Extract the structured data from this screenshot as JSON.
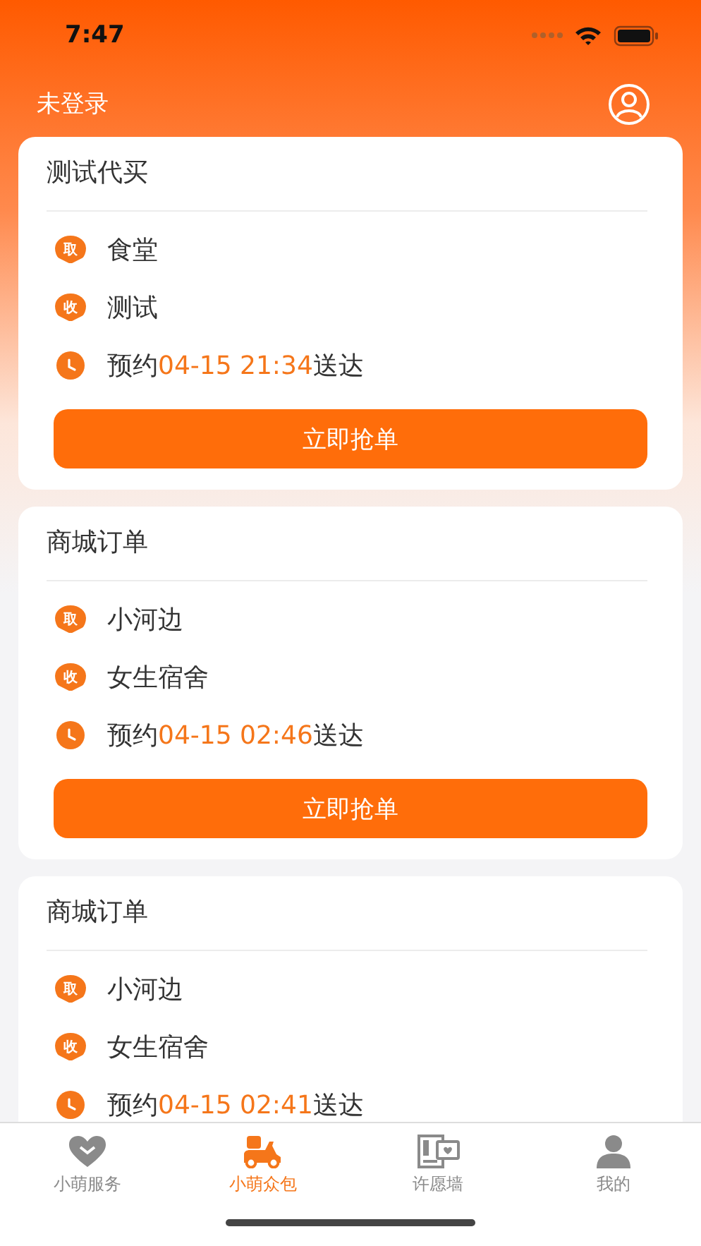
{
  "status_bar": {
    "time": "7:47"
  },
  "header": {
    "login_label": "未登录"
  },
  "orders": [
    {
      "title": "测试代买",
      "pickup_badge": "取",
      "pickup": "食堂",
      "dropoff_badge": "收",
      "dropoff": "测试",
      "time_prefix": "预约",
      "time": "04-15 21:34",
      "time_suffix": "送达",
      "button": "立即抢单"
    },
    {
      "title": "商城订单",
      "pickup_badge": "取",
      "pickup": "小河边",
      "dropoff_badge": "收",
      "dropoff": "女生宿舍",
      "time_prefix": "预约",
      "time": "04-15 02:46",
      "time_suffix": "送达",
      "button": "立即抢单"
    },
    {
      "title": "商城订单",
      "pickup_badge": "取",
      "pickup": "小河边",
      "dropoff_badge": "收",
      "dropoff": "女生宿舍",
      "time_prefix": "预约",
      "time": "04-15 02:41",
      "time_suffix": "送达"
    }
  ],
  "tabs": [
    {
      "label": "小萌服务",
      "kind": "heart",
      "selected": false
    },
    {
      "label": "小萌众包",
      "kind": "scooter",
      "selected": true
    },
    {
      "label": "许愿墙",
      "kind": "wall",
      "selected": false
    },
    {
      "label": "我的",
      "kind": "person",
      "selected": false
    }
  ]
}
